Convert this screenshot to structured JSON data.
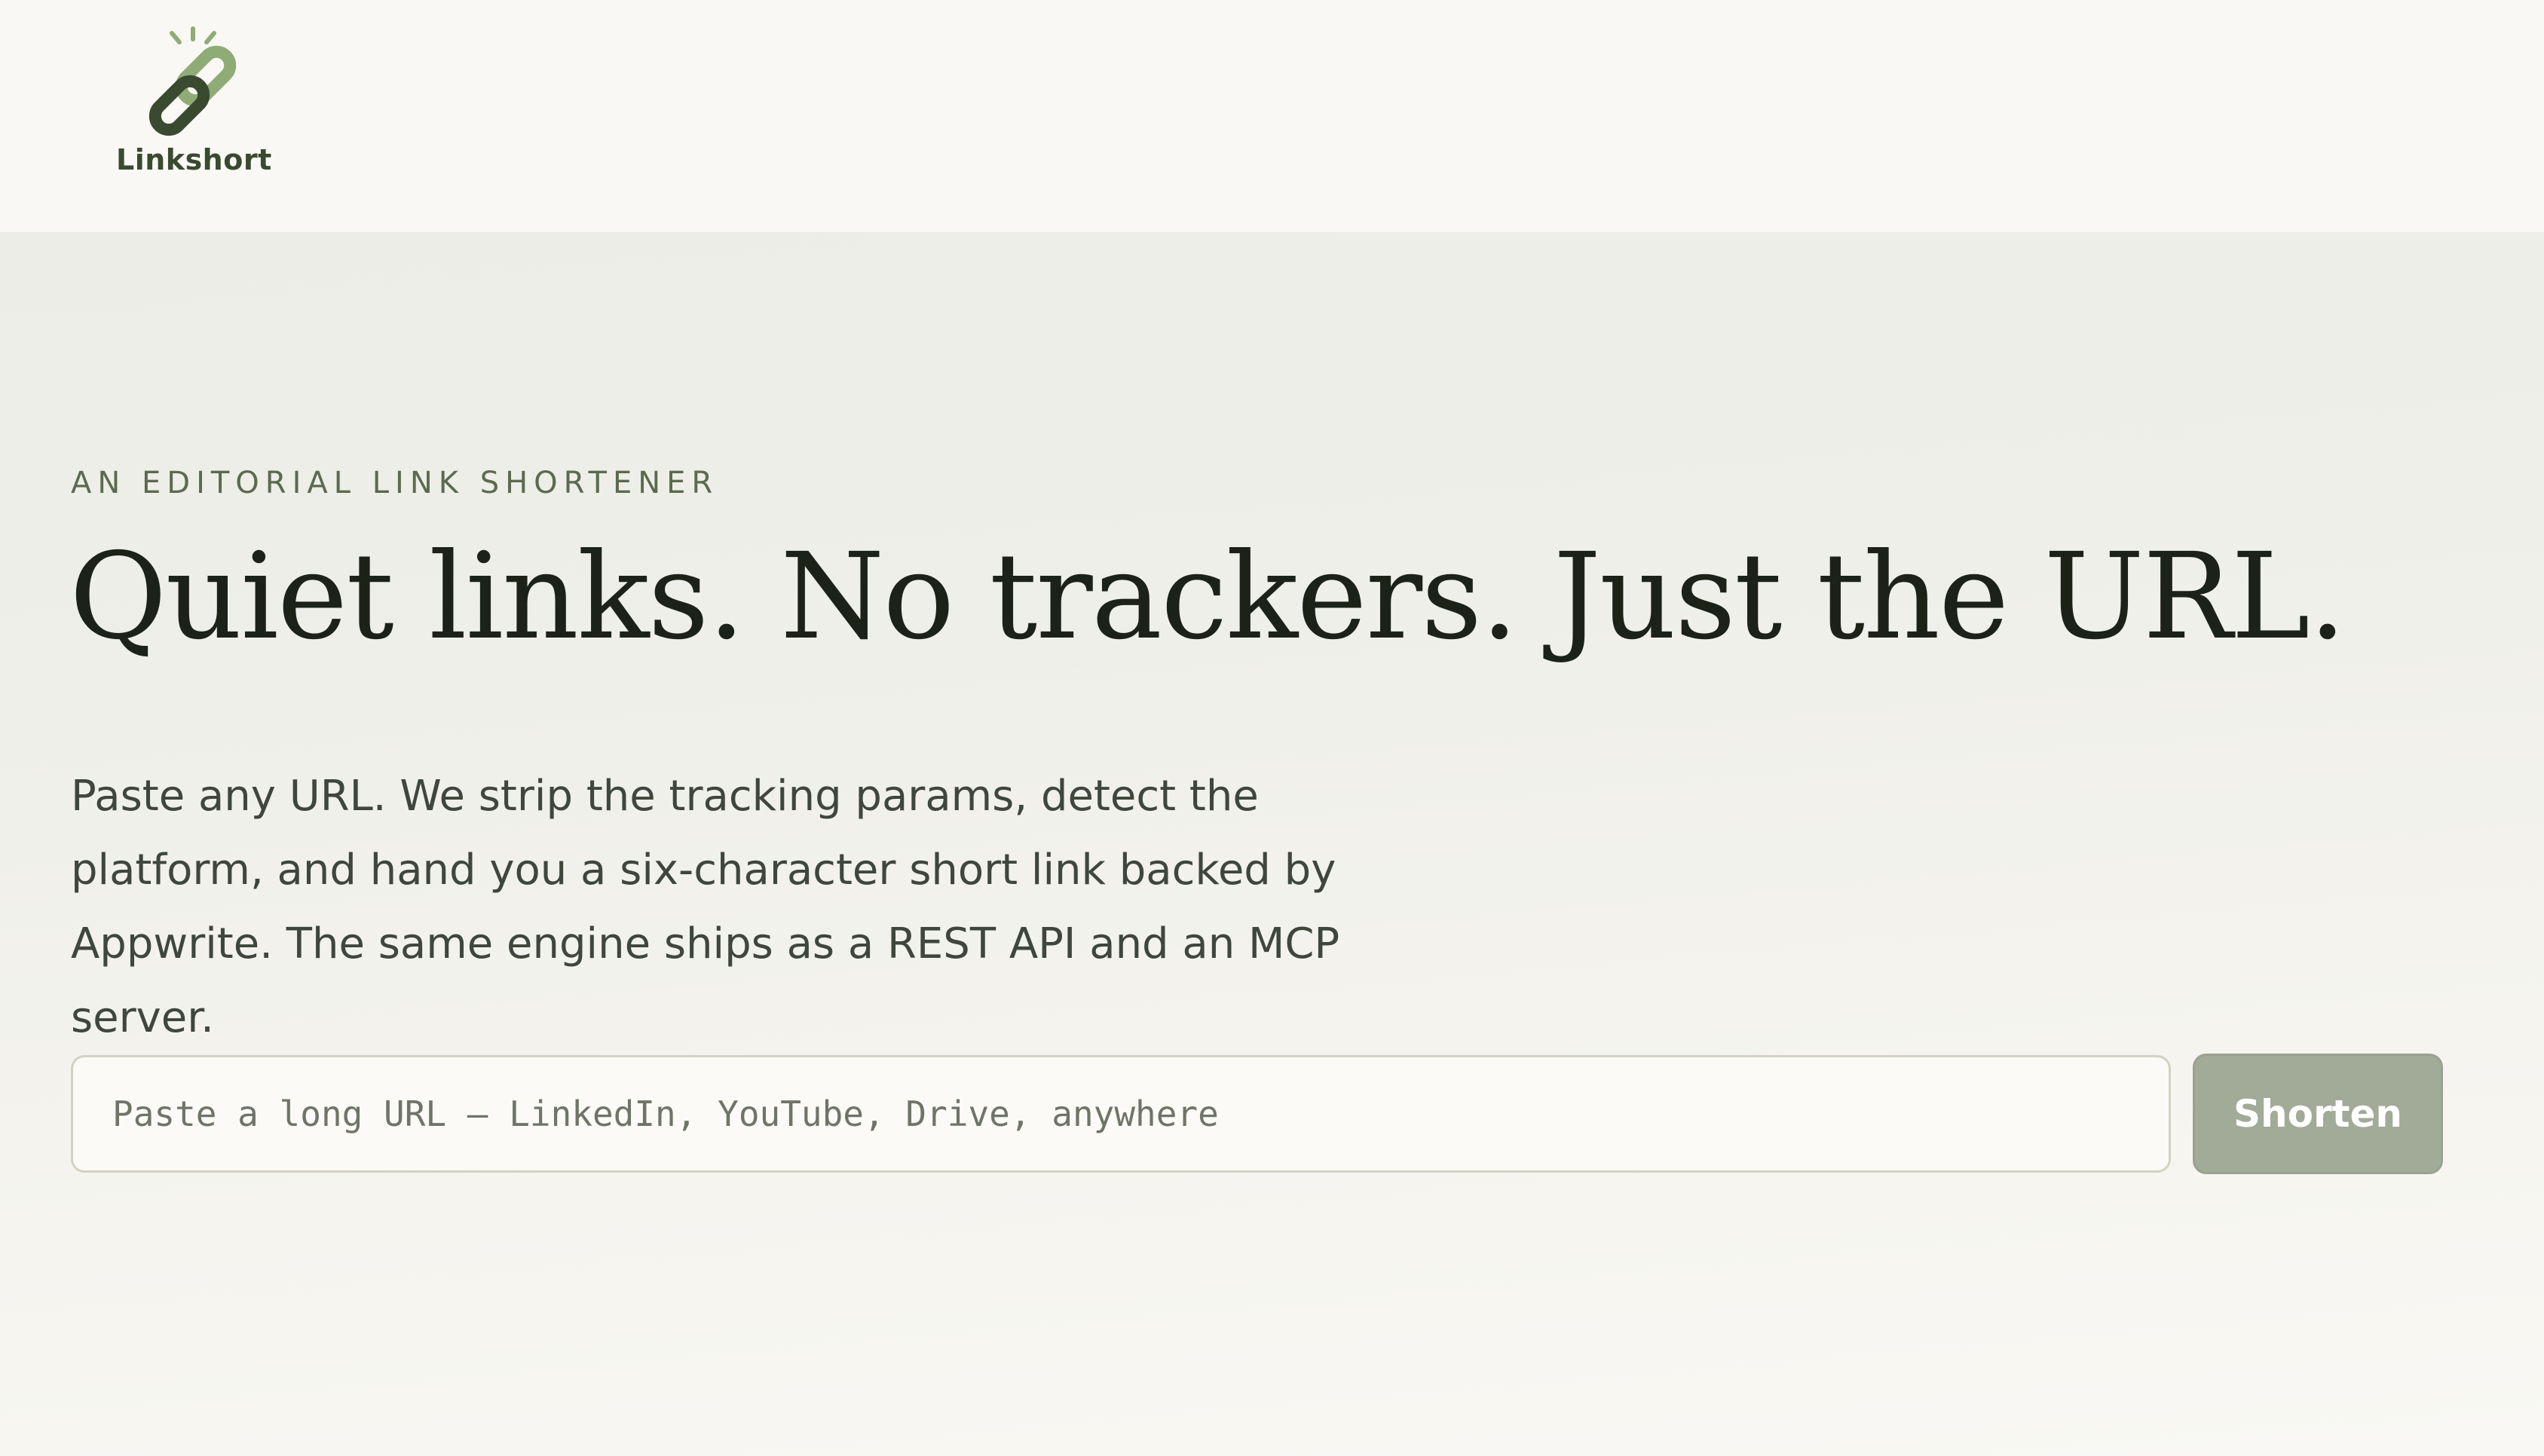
{
  "brand": {
    "name": "Linkshort",
    "logo_icon": "chain-link-icon",
    "colors": {
      "dark": "#3a4a30",
      "light": "#8fac76"
    }
  },
  "hero": {
    "eyebrow": "AN EDITORIAL LINK SHORTENER",
    "headline": "Quiet links. No trackers. Just the URL.",
    "description": "Paste any URL. We strip the tracking params, detect the platform, and hand you a six-character short link backed by Appwrite. The same engine ships as a REST API and an MCP server."
  },
  "shortener": {
    "input_value": "",
    "input_placeholder": "Paste a long URL — LinkedIn, YouTube, Drive, anywhere",
    "button_label": "Shorten",
    "button_color": "#a2aa98"
  }
}
